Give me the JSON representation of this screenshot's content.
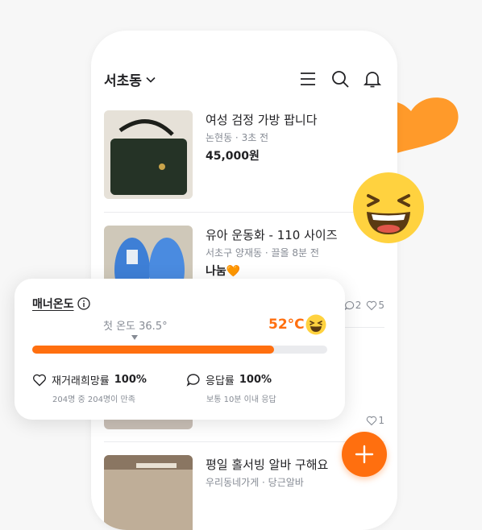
{
  "header": {
    "location": "서초동"
  },
  "items": [
    {
      "title": "여성 검정 가방 팝니다",
      "meta": "논현동 · 3초 전",
      "price": "45,000원"
    },
    {
      "title": "유아 운동화 - 110 사이즈",
      "meta": "서초구 양재동 · 끌올 8분 전",
      "price": "나눔🧡",
      "chats": "2",
      "likes": "5"
    },
    {
      "likes": "1"
    },
    {
      "title": "평일 홀서빙 알바 구해요",
      "meta": "우리동네가게 · 당근알바"
    }
  ],
  "manner": {
    "title": "매너온도",
    "first_temp": "첫 온도 36.5°",
    "temperature": "52°C",
    "progress": 0.82,
    "stats": [
      {
        "label": "재거래희망률",
        "value": "100%",
        "sub": "204명 중 204명이 만족"
      },
      {
        "label": "응답률",
        "value": "100%",
        "sub": "보통 10분 이내 응답"
      }
    ]
  },
  "colors": {
    "accent": "#ff6f0f",
    "heart": "#ff9a2a",
    "emoji": "#ffd23f"
  },
  "icons": [
    "chevron-down-icon",
    "menu-icon",
    "search-icon",
    "bell-icon",
    "info-icon",
    "heart-icon",
    "chat-icon",
    "plus-icon",
    "laugh-emoji-icon"
  ]
}
